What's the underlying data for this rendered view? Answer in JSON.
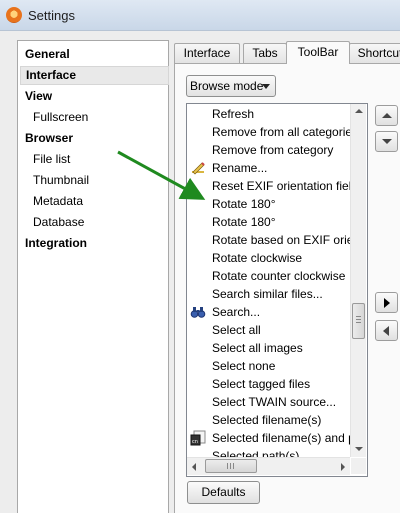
{
  "window": {
    "title": "Settings"
  },
  "categories": [
    {
      "label": "General",
      "level": "top",
      "selected": false
    },
    {
      "label": "Interface",
      "level": "top",
      "selected": true
    },
    {
      "label": "View",
      "level": "top",
      "selected": false
    },
    {
      "label": "Fullscreen",
      "level": "sub",
      "selected": false
    },
    {
      "label": "Browser",
      "level": "top",
      "selected": false
    },
    {
      "label": "File list",
      "level": "sub",
      "selected": false
    },
    {
      "label": "Thumbnail",
      "level": "sub",
      "selected": false
    },
    {
      "label": "Metadata",
      "level": "sub",
      "selected": false
    },
    {
      "label": "Database",
      "level": "sub",
      "selected": false
    },
    {
      "label": "Integration",
      "level": "top",
      "selected": false
    }
  ],
  "tabs": [
    {
      "label": "Interface",
      "active": false
    },
    {
      "label": "Tabs",
      "active": false
    },
    {
      "label": "ToolBar",
      "active": true
    },
    {
      "label": "Shortcut",
      "active": false
    }
  ],
  "mode_select": {
    "value": "Browse mode"
  },
  "actions": [
    {
      "label": "Refresh",
      "icon": ""
    },
    {
      "label": "Remove from all categories",
      "icon": ""
    },
    {
      "label": "Remove from category",
      "icon": ""
    },
    {
      "label": "Rename...",
      "icon": "pencil-icon"
    },
    {
      "label": "Reset EXIF orientation field",
      "icon": ""
    },
    {
      "label": "Rotate 180°",
      "icon": ""
    },
    {
      "label": "Rotate 180°",
      "icon": ""
    },
    {
      "label": "Rotate based on EXIF orientation",
      "icon": ""
    },
    {
      "label": "Rotate clockwise",
      "icon": ""
    },
    {
      "label": "Rotate counter clockwise",
      "icon": ""
    },
    {
      "label": "Search similar files...",
      "icon": ""
    },
    {
      "label": "Search...",
      "icon": "binoculars-icon"
    },
    {
      "label": "Select all",
      "icon": ""
    },
    {
      "label": "Select all images",
      "icon": ""
    },
    {
      "label": "Select none",
      "icon": ""
    },
    {
      "label": "Select tagged files",
      "icon": ""
    },
    {
      "label": "Select TWAIN source...",
      "icon": ""
    },
    {
      "label": "Selected filename(s)",
      "icon": ""
    },
    {
      "label": "Selected filename(s) and path",
      "icon": "clipboard-copy-icon"
    },
    {
      "label": "Selected path(s)",
      "icon": ""
    }
  ],
  "buttons": {
    "defaults": "Defaults"
  },
  "colors": {
    "annotation_arrow": "#1f8a1f",
    "tree_selection": "#e9e9e9"
  }
}
